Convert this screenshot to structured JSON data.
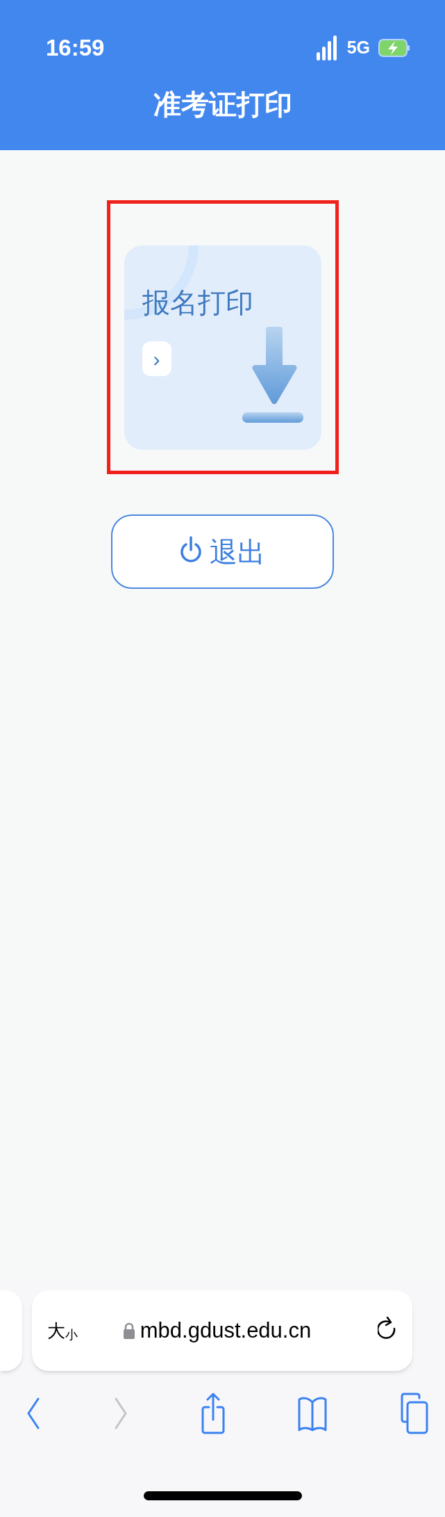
{
  "status_bar": {
    "time": "16:59",
    "network": "5G"
  },
  "header": {
    "title": "准考证打印"
  },
  "print_card": {
    "title": "报名打印",
    "arrow": "›",
    "highlighted": true
  },
  "exit_button": {
    "label": "退出"
  },
  "browser": {
    "text_size": {
      "large": "大",
      "small": "小"
    },
    "url": "mbd.gdust.edu.cn",
    "toolbar": [
      {
        "kind": "back",
        "disabled": false
      },
      {
        "kind": "forward",
        "disabled": true
      },
      {
        "kind": "share",
        "disabled": false
      },
      {
        "kind": "bookmarks",
        "disabled": false
      },
      {
        "kind": "tabs",
        "disabled": false
      }
    ]
  }
}
